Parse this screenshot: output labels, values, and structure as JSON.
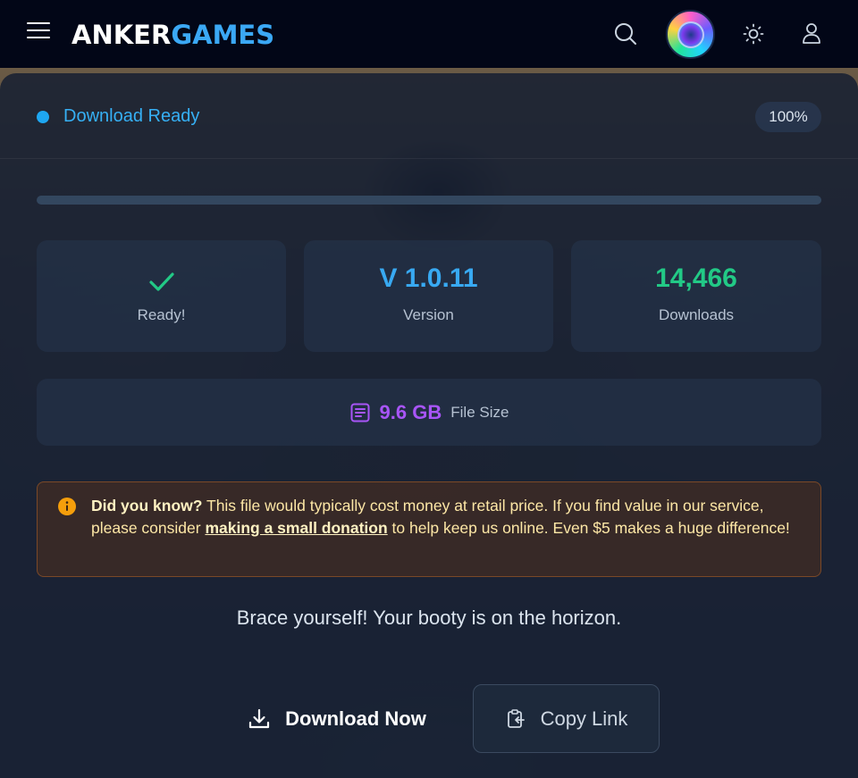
{
  "header": {
    "logo_part1": "ANKER",
    "logo_part2": "GAMES",
    "icons": [
      "menu-icon",
      "search-icon",
      "avatar",
      "sun-icon",
      "user-icon"
    ]
  },
  "status": {
    "label": "Download Ready",
    "percent": "100%",
    "progress_fraction": 1.0,
    "dot_color": "#1ea7f2"
  },
  "stats": {
    "ready_label": "Ready!",
    "version_value": "V 1.0.11",
    "version_label": "Version",
    "downloads_value": "14,466",
    "downloads_label": "Downloads"
  },
  "file": {
    "size_value": "9.6 GB",
    "size_label": "File Size"
  },
  "notice": {
    "lead": "Did you know?",
    "text_1": " This file would typically cost money at retail price. If you find value in our service, please consider ",
    "link": "making a small donation",
    "text_2": " to help keep us online. Even $5 makes a huge difference!"
  },
  "tagline": "Brace yourself! Your booty is on the horizon.",
  "actions": {
    "download_label": "Download Now",
    "copy_label": "Copy Link"
  },
  "colors": {
    "accent_blue": "#38a9f2",
    "accent_green": "#22c986",
    "accent_purple": "#a855f7",
    "notice_text": "#fde7a6"
  }
}
